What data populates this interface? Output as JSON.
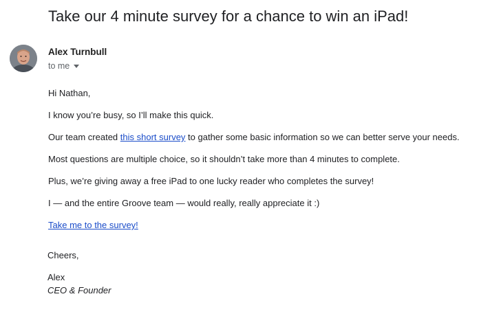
{
  "email": {
    "subject": "Take our 4 minute survey for a chance to win an iPad!",
    "sender": {
      "name": "Alex Turnbull",
      "avatar_icon": "person-photo-icon"
    },
    "recipient_label": "to me",
    "body": {
      "greeting": "Hi Nathan,",
      "line1": "I know you’re busy, so I’ll make this quick.",
      "line2": {
        "before": "Our team created ",
        "link": "this short survey",
        "after": " to gather some basic information so we can better serve your needs."
      },
      "line3": "Most questions are multiple choice, so it shouldn’t take more than 4 minutes to complete.",
      "line4": "Plus, we’re giving away a free iPad to one lucky reader who completes the survey!",
      "line5": "I — and the entire Groove team — would really, really appreciate it :)",
      "cta_link": "Take me to the survey!",
      "closing": "Cheers,",
      "signature_name": "Alex",
      "signature_title": "CEO & Founder"
    },
    "colors": {
      "link": "#1a4cc9",
      "text": "#202124",
      "muted": "#5f6368"
    }
  }
}
